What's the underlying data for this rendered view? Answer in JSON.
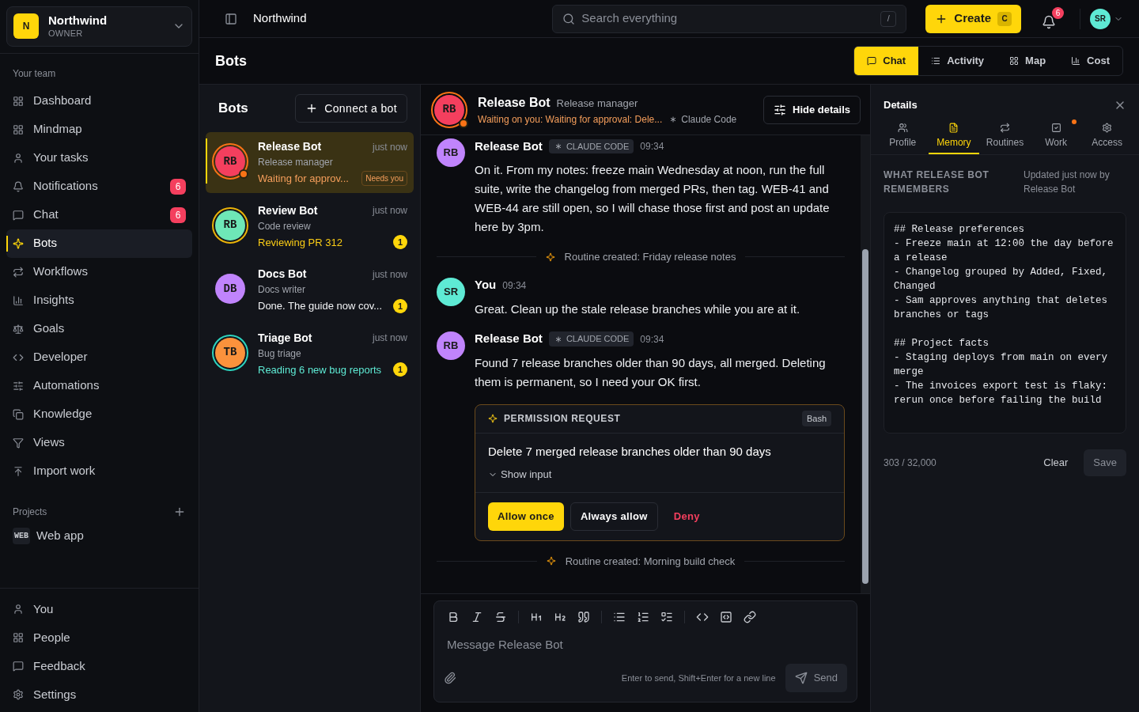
{
  "workspace": {
    "initial": "N",
    "name": "Northwind",
    "role": "OWNER"
  },
  "sidebar": {
    "team_label": "Your team",
    "items": [
      {
        "label": "Dashboard",
        "selected": false
      },
      {
        "label": "Mindmap",
        "selected": false
      },
      {
        "label": "Your tasks",
        "selected": false
      },
      {
        "label": "Notifications",
        "selected": false,
        "count": "6"
      },
      {
        "label": "Chat",
        "selected": false,
        "count": "6"
      },
      {
        "label": "Bots",
        "selected": true
      },
      {
        "label": "Workflows",
        "selected": false
      },
      {
        "label": "Insights",
        "selected": false
      },
      {
        "label": "Goals",
        "selected": false
      },
      {
        "label": "Developer",
        "selected": false
      },
      {
        "label": "Automations",
        "selected": false
      },
      {
        "label": "Knowledge",
        "selected": false
      },
      {
        "label": "Views",
        "selected": false
      },
      {
        "label": "Import work",
        "selected": false
      }
    ],
    "projects_label": "Projects",
    "projects": [
      {
        "tag": "WEB",
        "name": "Web app"
      }
    ],
    "footer_items": [
      {
        "label": "You"
      },
      {
        "label": "People"
      },
      {
        "label": "Feedback"
      },
      {
        "label": "Settings"
      }
    ]
  },
  "topbar": {
    "title": "Northwind",
    "search": {
      "placeholder": "Search everything",
      "shortcut": "/"
    },
    "create": {
      "label": "Create",
      "shortcut": "C"
    },
    "notification_count": "6",
    "user_initials": "SR"
  },
  "page": {
    "title": "Bots",
    "views": [
      {
        "label": "Chat",
        "selected": true
      },
      {
        "label": "Activity",
        "selected": false
      },
      {
        "label": "Map",
        "selected": false
      },
      {
        "label": "Cost",
        "selected": false
      }
    ]
  },
  "bot_list": {
    "title": "Bots",
    "connect_button": "Connect a bot",
    "bots": [
      {
        "initials": "RB",
        "name": "Release Bot",
        "role": "Release manager",
        "time": "just now",
        "status": "Waiting for approv...",
        "kind": "waiting",
        "color": "#f43f5e",
        "alert": true,
        "badge": {
          "kind": "tag",
          "text": "Needs you"
        },
        "selected": true
      },
      {
        "initials": "RB",
        "name": "Review Bot",
        "role": "Code review",
        "time": "just now",
        "status": "Reviewing PR 312",
        "kind": "working",
        "color": "#6ee7b7",
        "alert": false,
        "badge": {
          "kind": "count",
          "text": "1"
        },
        "selected": false
      },
      {
        "initials": "DB",
        "name": "Docs Bot",
        "role": "Docs writer",
        "time": "just now",
        "status": "Done. The guide now cov...",
        "kind": "done",
        "color": "#c084fc",
        "alert": false,
        "badge": {
          "kind": "count",
          "text": "1"
        },
        "selected": false
      },
      {
        "initials": "TB",
        "name": "Triage Bot",
        "role": "Bug triage",
        "time": "just now",
        "status": "Reading 6 new bug reports",
        "kind": "reading",
        "color": "#fb923c",
        "alert": false,
        "badge": {
          "kind": "count",
          "text": "1"
        },
        "selected": false
      }
    ]
  },
  "chat": {
    "header": {
      "initials": "RB",
      "name": "Release Bot",
      "role": "Release manager",
      "status": "Waiting on you: Waiting for approval: Dele...",
      "source": "Claude Code",
      "hide_button": "Hide details"
    },
    "messages": [
      {
        "kind": "message",
        "initials": "RB",
        "color": "#c084fc",
        "author": "Release Bot",
        "tag": "CLAUDE CODE",
        "time": "09:34",
        "text": "On it. From my notes: freeze main Wednesday at noon, run the full suite, write the changelog from merged PRs, then tag. WEB-41 and WEB-44 are still open, so I will chase those first and post an update here by 3pm."
      },
      {
        "kind": "event",
        "text": "Routine created: Friday release notes"
      },
      {
        "kind": "message",
        "initials": "SR",
        "color": "#5eead4",
        "author": "You",
        "time": "09:34",
        "text": "Great. Clean up the stale release branches while you are at it."
      },
      {
        "kind": "message",
        "initials": "RB",
        "color": "#c084fc",
        "author": "Release Bot",
        "tag": "CLAUDE CODE",
        "time": "09:34",
        "text": "Found 7 release branches older than 90 days, all merged. Deleting them is permanent, so I need your OK first."
      },
      {
        "kind": "permission",
        "title": "PERMISSION REQUEST",
        "tool": "Bash",
        "text": "Delete 7 merged release branches older than 90 days",
        "toggle": "Show input",
        "expanded": false,
        "actions": [
          {
            "kind": "primary",
            "label": "Allow once"
          },
          {
            "kind": "secondary",
            "label": "Always allow"
          },
          {
            "kind": "danger",
            "label": "Deny"
          }
        ]
      },
      {
        "kind": "event",
        "text": "Routine created: Morning build check"
      }
    ],
    "composer": {
      "placeholder": "Message Release Bot",
      "hint": "Enter to send, Shift+Enter for a new line",
      "send": "Send"
    }
  },
  "details": {
    "title": "Details",
    "tabs": [
      {
        "label": "Profile",
        "selected": false,
        "alert": false
      },
      {
        "label": "Memory",
        "selected": true,
        "alert": false
      },
      {
        "label": "Routines",
        "selected": false,
        "alert": false
      },
      {
        "label": "Work",
        "selected": false,
        "alert": true
      },
      {
        "label": "Access",
        "selected": false,
        "alert": false
      }
    ],
    "heading": "WHAT RELEASE BOT REMEMBERS",
    "updated": "Updated just now by Release Bot",
    "memory": "## Release preferences\n- Freeze main at 12:00 the day before a release\n- Changelog grouped by Added, Fixed, Changed\n- Sam approves anything that deletes branches or tags\n\n## Project facts\n- Staging deploys from main on every merge\n- The invoices export test is flaky: rerun once before failing the build",
    "count": "303 / 32,000",
    "clear": "Clear",
    "save": "Save"
  }
}
